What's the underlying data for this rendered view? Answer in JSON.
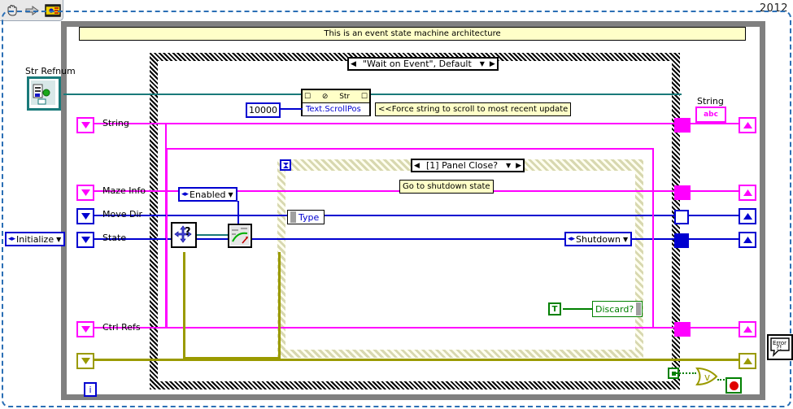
{
  "toolbar": {
    "icons": [
      {
        "name": "hand-tool-icon",
        "label": "Hand Tool"
      },
      {
        "name": "run-arrow-icon",
        "label": "Run"
      },
      {
        "name": "vi-icon",
        "label": "VI Icon"
      }
    ]
  },
  "version_badge": "2012",
  "banner": {
    "text": "This is an event state machine architecture"
  },
  "event_structure": {
    "selector": "\"Wait on Event\", Default",
    "left_arrow": "◀",
    "right_arrow": "▶",
    "dropdown": "▼",
    "timeout_terminal": "timeout-terminal"
  },
  "case_structure": {
    "selector": "[1] Panel Close?",
    "left_arrow": "◀",
    "right_arrow": "▶",
    "dropdown": "▼"
  },
  "controls": [
    {
      "label": "Str Refnum",
      "type": "refnum",
      "color": "#1a7a7a"
    },
    {
      "label": "String",
      "type": "shift-register",
      "color": "#ff00ff"
    },
    {
      "label": "Maze Info",
      "type": "shift-register",
      "color": "#ff00ff"
    },
    {
      "label": "Move Dir",
      "type": "shift-register",
      "color": "#0000d0"
    },
    {
      "label": "State",
      "type": "shift-register",
      "color": "#0000d0"
    },
    {
      "label": "Ctrl Refs",
      "type": "shift-register",
      "color": "#ff00ff"
    }
  ],
  "constants": {
    "initialize": "Initialize",
    "enabled": "Enabled",
    "shutdown": "Shutdown",
    "scroll_value": "10000",
    "true_constant": "T"
  },
  "property_node": {
    "header": "Str",
    "property": "Text.ScrollPos"
  },
  "comments": {
    "scroll": "<<Force string to scroll to most recent update",
    "shutdown": "Go to shutdown state"
  },
  "nodes": {
    "type_terminal": "Type",
    "discard_terminal": "Discard?",
    "error_dialog": "Error",
    "error_dialog_sub": "?!",
    "iteration_terminal": "i",
    "or_gate": "v"
  },
  "indicators": [
    {
      "label": "String",
      "glyph": "abc",
      "color": "#ff00ff"
    }
  ],
  "colors": {
    "loop_gray": "#808080",
    "banner_yellow": "#ffffc8",
    "magenta": "#ff00ff",
    "blue": "#0000d0",
    "teal": "#1a7a7a",
    "error_yellow": "#9a9a00",
    "green": "#008000",
    "red": "#e00000"
  }
}
